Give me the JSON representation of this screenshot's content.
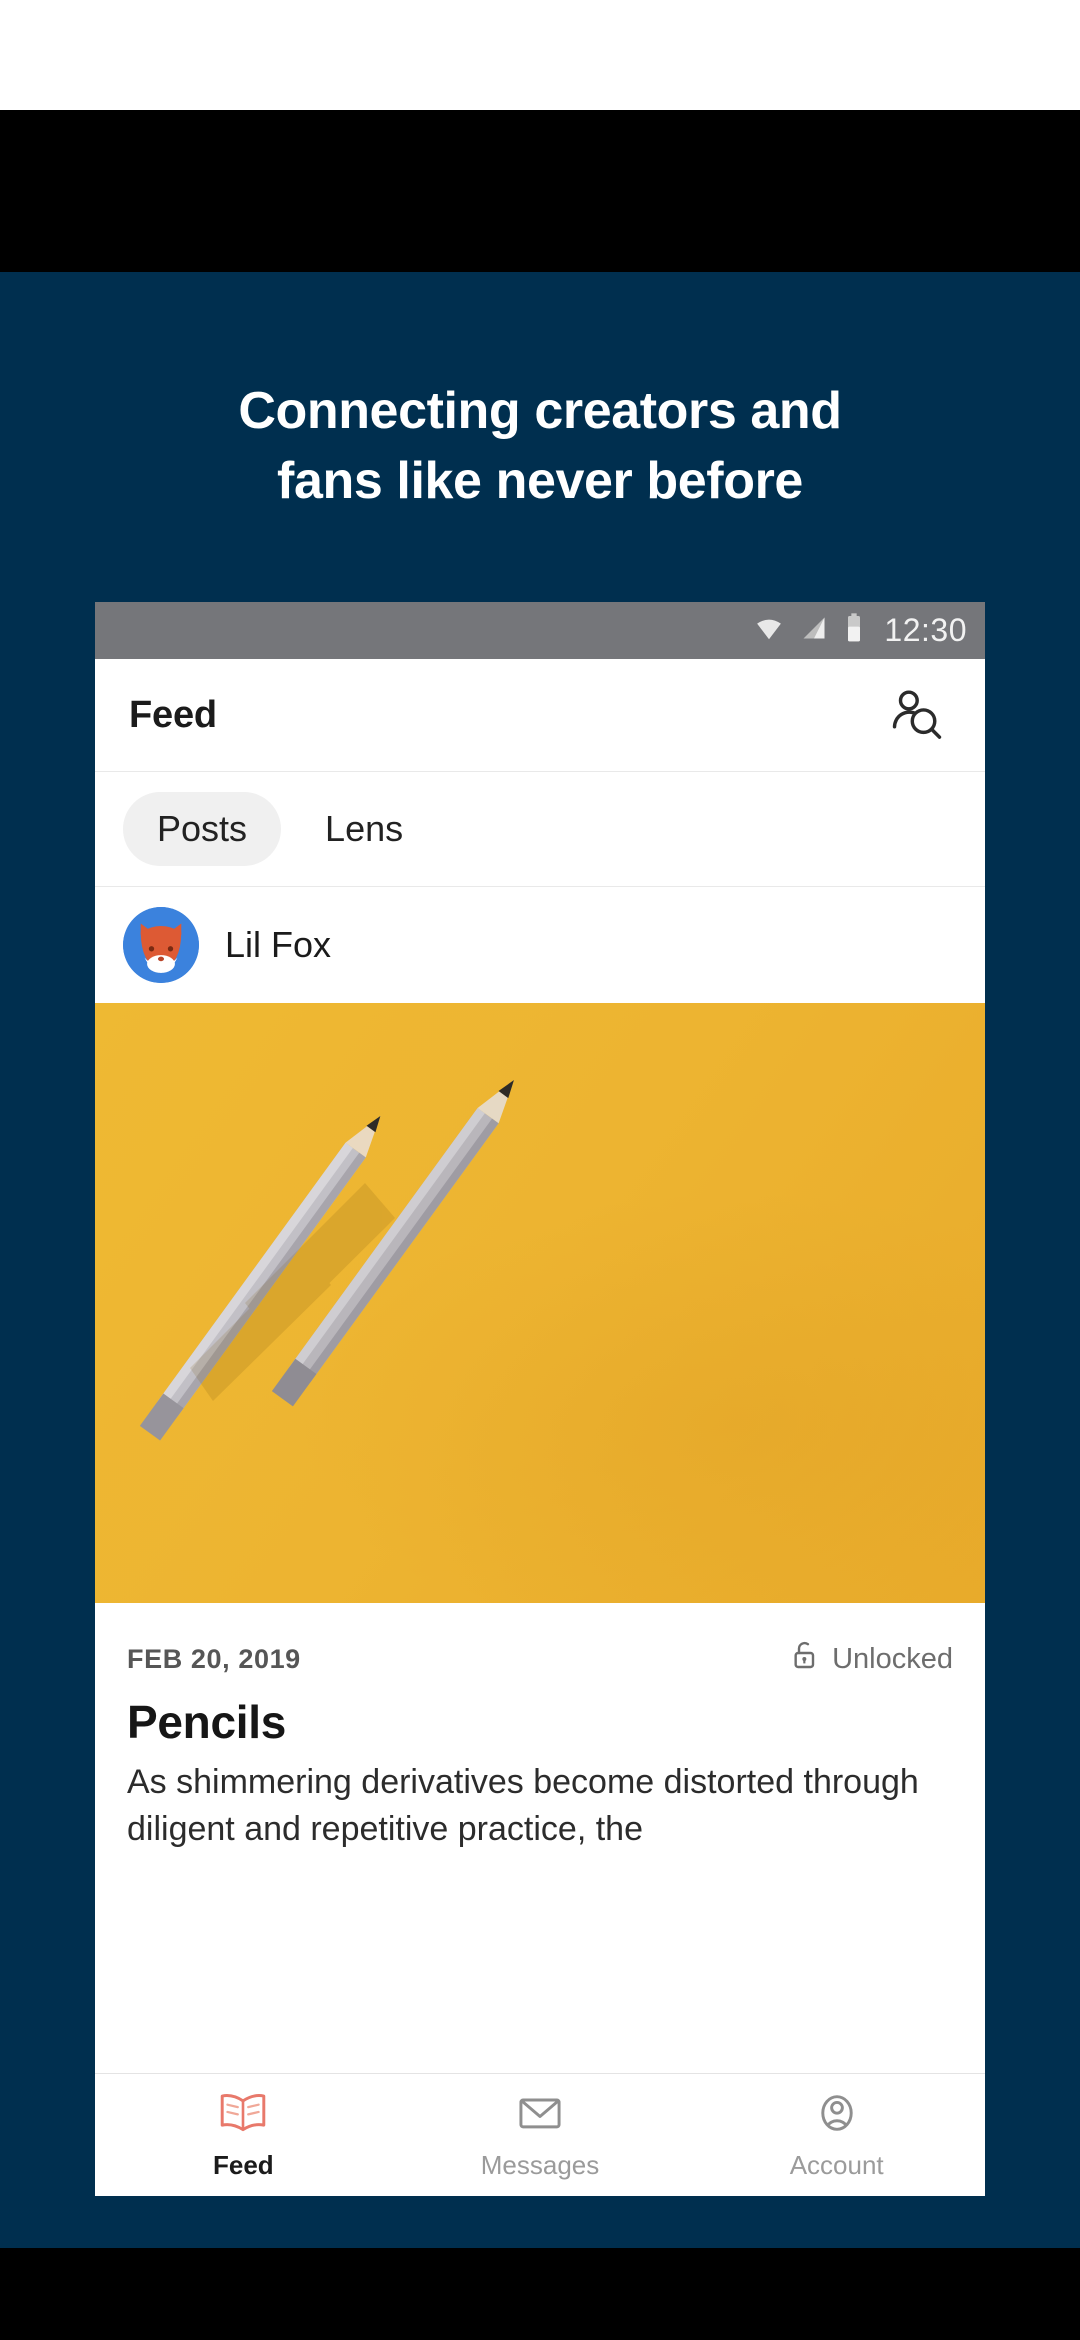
{
  "promo": {
    "headline_line1": "Connecting creators and",
    "headline_line2": "fans like never before",
    "background_color": "#002f4f",
    "text_color": "#ffffff"
  },
  "status_bar": {
    "time": "12:30",
    "icons": [
      "wifi-icon",
      "cell-signal-icon",
      "battery-icon"
    ],
    "background_color": "#75767a"
  },
  "app_bar": {
    "title": "Feed",
    "action_icon": "person-search-icon"
  },
  "tabs": [
    {
      "label": "Posts",
      "active": true
    },
    {
      "label": "Lens",
      "active": false
    }
  ],
  "author": {
    "name": "Lil Fox",
    "avatar_icon": "fox-avatar-icon",
    "avatar_background": "#3b82dd",
    "fox_color": "#dd5a34"
  },
  "hero": {
    "image_description": "two sharpened gray pencils on a yellow background",
    "background_color": "#edb432",
    "pencil_color": "#b9b6bb"
  },
  "post": {
    "date": "FEB 20, 2019",
    "access_label": "Unlocked",
    "access_icon": "unlock-icon",
    "title": "Pencils",
    "body": "As shimmering derivatives become distorted through diligent and repetitive practice, the"
  },
  "bottom_nav": [
    {
      "label": "Feed",
      "icon": "open-book-icon",
      "active": true,
      "color": "#e8796b"
    },
    {
      "label": "Messages",
      "icon": "envelope-icon",
      "active": false,
      "color": "#9b9b9b"
    },
    {
      "label": "Account",
      "icon": "account-circle-icon",
      "active": false,
      "color": "#9b9b9b"
    }
  ]
}
